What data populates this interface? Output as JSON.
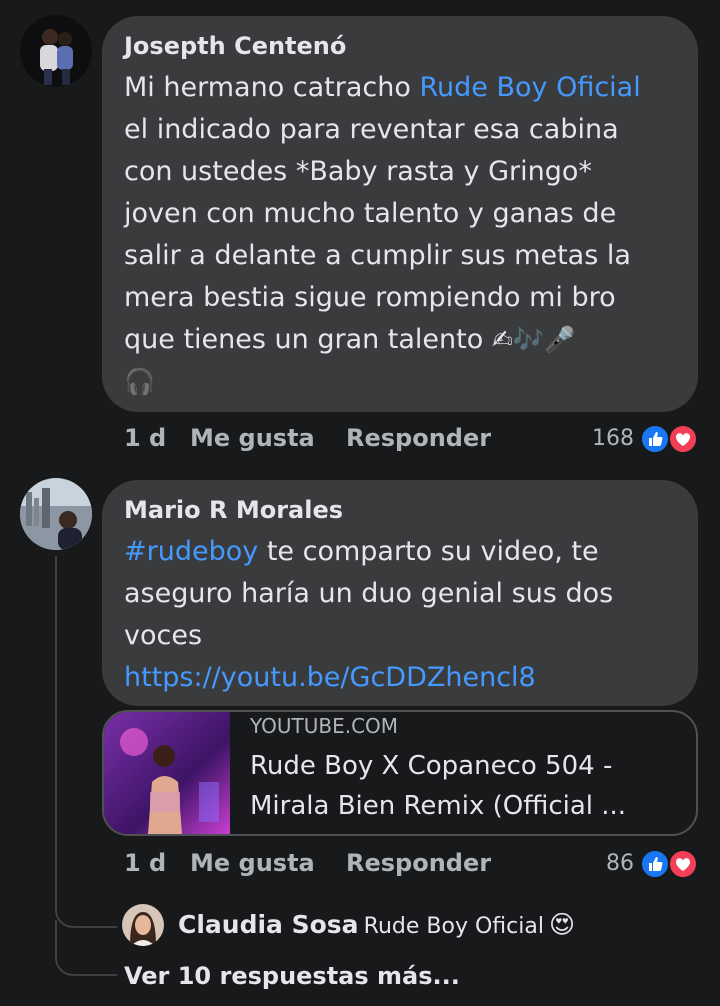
{
  "comments": [
    {
      "author": "Josepth Centenó",
      "text": {
        "line1_prefix": "Mi hermano catracho ",
        "line1_mention": "Rude Boy Oficial",
        "line2": "el indicado para reventar esa cabina",
        "line3": "con ustedes *Baby rasta y Gringo*",
        "line4": "joven con mucho talento y ganas de",
        "line5": "salir a delante a cumplir sus metas la",
        "line6": "mera bestia sigue rompiendo mi bro",
        "line7": "que tienes un gran talento",
        "line7_emojis": "✍🎶🎤",
        "line8_emoji": "🎧"
      },
      "time": "1 d",
      "like_label": "Me gusta",
      "reply_label": "Responder",
      "reaction_count": "168"
    },
    {
      "author": "Mario R Morales",
      "text": {
        "line1_hashtag": "#rudeboy",
        "line1_rest": " te comparto su video, te",
        "line2": "aseguro haría un duo genial sus dos",
        "line3": "voces",
        "link": "https://youtu.be/GcDDZhencl8"
      },
      "preview": {
        "domain": "YOUTUBE.COM",
        "title_line1": "Rude Boy X Copaneco 504 -",
        "title_line2": "Mirala Bien Remix (Official ..."
      },
      "time": "1 d",
      "like_label": "Me gusta",
      "reply_label": "Responder",
      "reaction_count": "86"
    }
  ],
  "reply": {
    "author": "Claudia Sosa",
    "text": "Rude Boy Oficial",
    "emoji": "😍"
  },
  "more_replies": "Ver 10 respuestas más...",
  "colors": {
    "background": "#18191a",
    "bubble": "#3a3b3c",
    "link": "#4599ff",
    "secondary_text": "#b0b3b8",
    "like_blue": "#1877f2",
    "love_red": "#f33e58"
  }
}
